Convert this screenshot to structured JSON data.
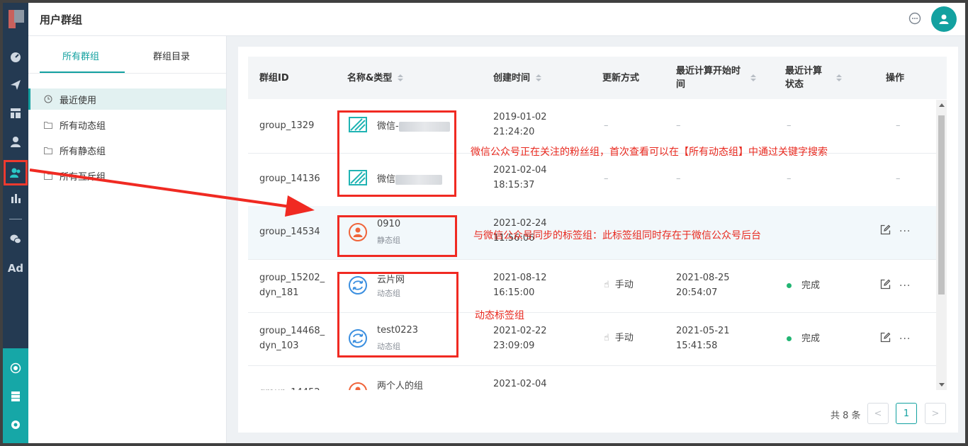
{
  "header": {
    "title": "用户群组"
  },
  "side": {
    "tabs": [
      "所有群组",
      "群组目录"
    ],
    "items": [
      "最近使用",
      "所有动态组",
      "所有静态组",
      "所有互斥组"
    ]
  },
  "table": {
    "headers": {
      "id": "群组ID",
      "name": "名称&类型",
      "created": "创建时间",
      "update": "更新方式",
      "last_start_1": "最近计算开始时",
      "last_start_2": "间",
      "last_status_1": "最近计算",
      "last_status_2": "状态",
      "ops": "操作"
    },
    "rows": [
      {
        "id_1": "group_1329",
        "id_2": "",
        "name": "微信-",
        "type": "",
        "created_1": "2019-01-02",
        "created_2": "21:24:20",
        "update": "–",
        "last": "–",
        "status": "–",
        "ops": "–"
      },
      {
        "id_1": "group_14136",
        "id_2": "",
        "name": "微信",
        "type": "",
        "created_1": "2021-02-04",
        "created_2": "18:15:37",
        "update": "–",
        "last": "–",
        "status": "–",
        "ops": "–"
      },
      {
        "id_1": "group_14534",
        "id_2": "",
        "name": "0910",
        "type": "静态组",
        "created_1": "2021-02-24",
        "created_2": "11:56:06",
        "update": "",
        "last": "",
        "status": ""
      },
      {
        "id_1": "group_15202_",
        "id_2": "dyn_181",
        "name": "云片网",
        "type": "动态组",
        "created_1": "2021-08-12",
        "created_2": "16:15:00",
        "update": "手动",
        "last_1": "2021-08-25",
        "last_2": "20:54:07",
        "status": "完成"
      },
      {
        "id_1": "group_14468_",
        "id_2": "dyn_103",
        "name": "test0223",
        "type": "动态组",
        "created_1": "2021-02-22",
        "created_2": "23:09:09",
        "update": "手动",
        "last_1": "2021-05-21",
        "last_2": "15:41:58",
        "status": "完成"
      },
      {
        "id_1": "group_14452",
        "name": "两个人的组",
        "created_1": "2021-02-04"
      }
    ]
  },
  "pagination": {
    "total": "共 8 条",
    "page": "1",
    "prev": "<",
    "next": ">"
  },
  "annotations": {
    "wechat_fans": "微信公众号正在关注的粉丝组，首次查看可以在【所有动态组】中通过关键字搜索",
    "wechat_tags": "与微信公众号同步的标签组：此标签组同时存在于微信公众号后台",
    "dynamic_tags": "动态标签组"
  },
  "rail_icons": [
    "dashboard-icon",
    "send-icon",
    "layout-icon",
    "user-icon",
    "user-group-icon",
    "bar-chart-icon",
    "wechat-icon",
    "ad-icon",
    "network-icon",
    "server-icon",
    "settings-icon"
  ],
  "rail_text": {
    "ad": "Ad"
  },
  "colors": {
    "accent": "#13a1a0",
    "annotation": "#f02a22",
    "rail": "#243a52",
    "rail_bottom": "#16a7a7",
    "dynamic_icon": "#3b8fe0",
    "static_icon": "#f0643a",
    "wechat_icon": "#1fb3b3"
  }
}
